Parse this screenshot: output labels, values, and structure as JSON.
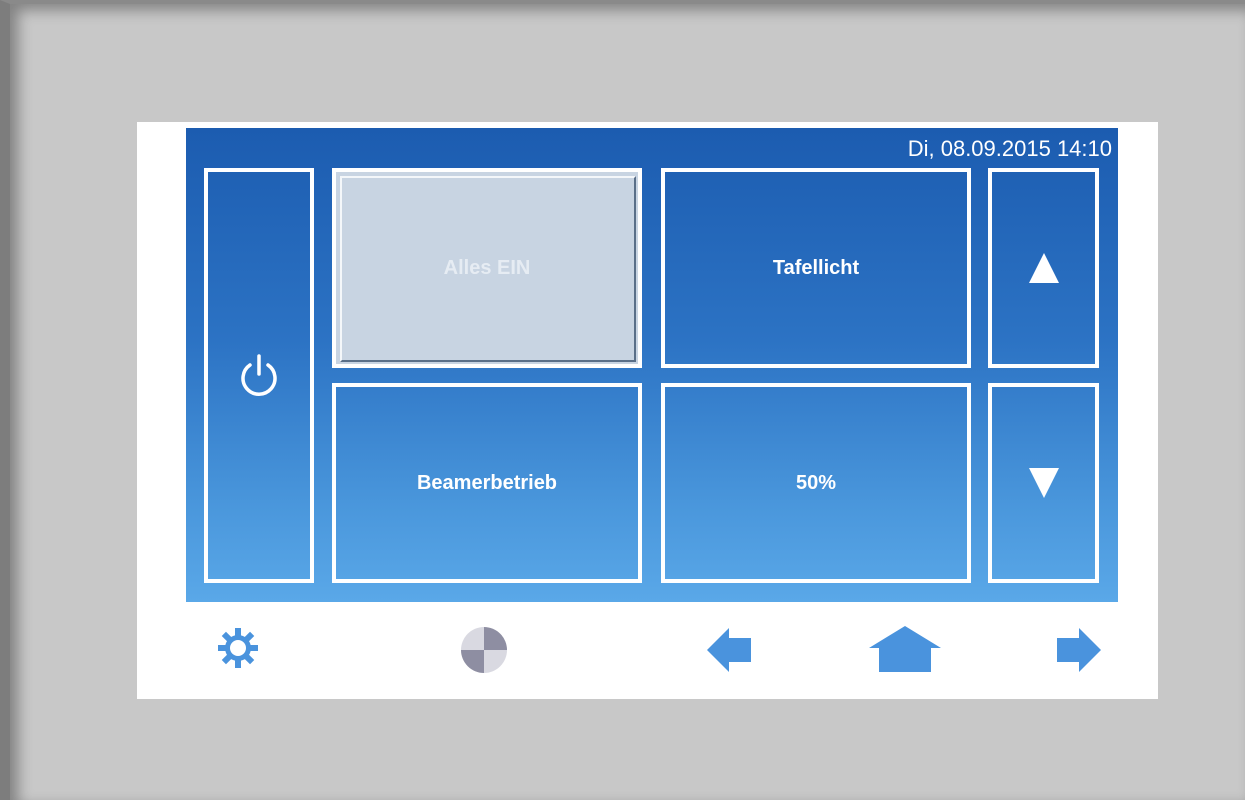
{
  "header": {
    "datetime": "Di, 08.09.2015 14:10"
  },
  "tiles": {
    "power": {
      "icon": "power-icon"
    },
    "alles_ein": {
      "label": "Alles EIN",
      "state": "pressed"
    },
    "tafellicht": {
      "label": "Tafellicht"
    },
    "beamerbetrieb": {
      "label": "Beamerbetrieb"
    },
    "dimmer": {
      "label": "50%"
    },
    "up": {
      "icon": "arrow-up-icon"
    },
    "down": {
      "icon": "arrow-down-icon"
    }
  },
  "bottom_bar": {
    "icons": [
      "settings-gear-icon",
      "display-mode-icon",
      "arrow-left-icon",
      "home-icon",
      "arrow-right-icon"
    ]
  },
  "colors": {
    "screen_top": "#1c5cb0",
    "screen_bottom": "#5aa8e8",
    "tile_border": "#ffffff",
    "pressed_tile": "#c8d4e2",
    "nav_icon": "#4a93dd"
  }
}
